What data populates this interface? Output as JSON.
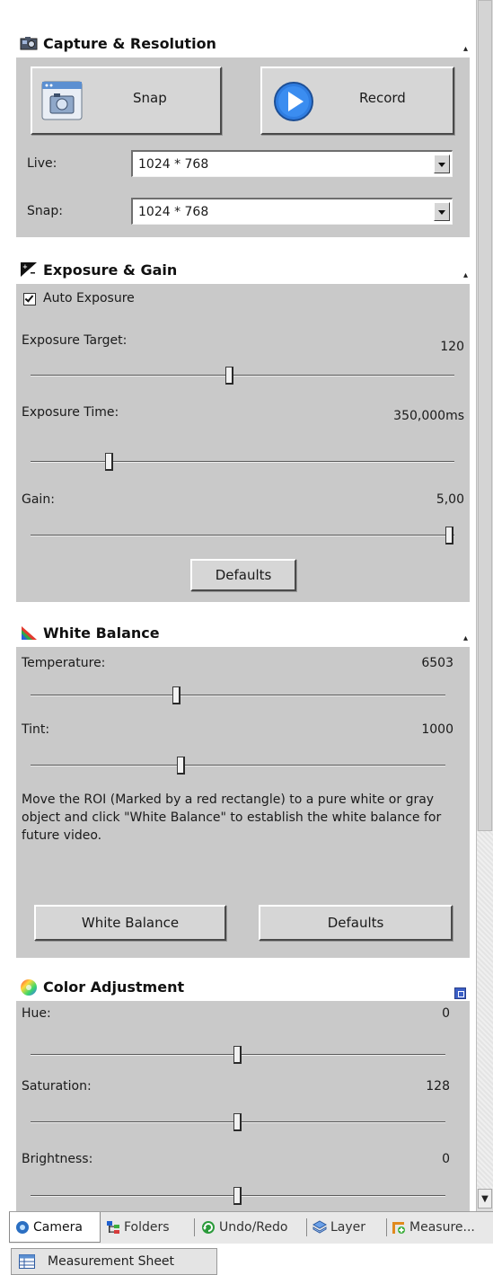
{
  "capture": {
    "title": "Capture & Resolution",
    "snap_label": "Snap",
    "record_label": "Record",
    "live_label": "Live:",
    "live_value": "1024 * 768",
    "snap_res_label": "Snap:",
    "snap_res_value": "1024 * 768"
  },
  "exposure": {
    "title": "Exposure & Gain",
    "auto_exposure_label": "Auto Exposure",
    "auto_exposure_checked": true,
    "target_label": "Exposure Target:",
    "target_value": "120",
    "target_level": 0.47,
    "time_label": "Exposure Time:",
    "time_value": "350,000ms",
    "time_level": 0.18,
    "gain_label": "Gain:",
    "gain_value": "5,00",
    "gain_level": 1.0,
    "defaults_label": "Defaults"
  },
  "white_balance": {
    "title": "White Balance",
    "temperature_label": "Temperature:",
    "temperature_value": "6503",
    "temperature_level": 0.35,
    "tint_label": "Tint:",
    "tint_value": "1000",
    "tint_level": 0.36,
    "help_text": "Move the ROI (Marked by a red rectangle) to a pure white or gray object and click \"White Balance\" to establish the white balance for future video.",
    "white_balance_button": "White Balance",
    "defaults_label": "Defaults"
  },
  "color": {
    "title": "Color Adjustment",
    "hue_label": "Hue:",
    "hue_value": "0",
    "hue_level": 0.5,
    "saturation_label": "Saturation:",
    "saturation_value": "128",
    "saturation_level": 0.5,
    "brightness_label": "Brightness:",
    "brightness_value": "0",
    "brightness_level": 0.5
  },
  "tabs": [
    {
      "label": "Camera",
      "icon": "camera-icon",
      "active": true
    },
    {
      "label": "Folders",
      "icon": "folders-icon",
      "active": false
    },
    {
      "label": "Undo/Redo",
      "icon": "undo-redo-icon",
      "active": false
    },
    {
      "label": "Layer",
      "icon": "layer-icon",
      "active": false
    },
    {
      "label": "Measure...",
      "icon": "measure-icon",
      "active": false
    }
  ],
  "bottom_tab": {
    "label": "Measurement Sheet",
    "icon": "measurement-sheet-icon"
  }
}
